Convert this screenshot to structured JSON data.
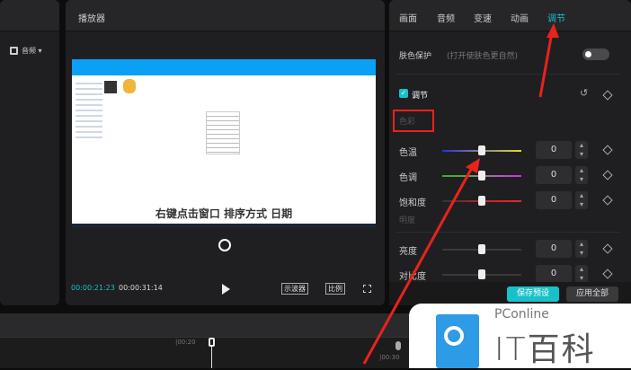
{
  "left_panel": {
    "dropdown_label": "音频"
  },
  "player": {
    "title": "播放器",
    "subtitle": "右键点击窗口 排序方式 日期",
    "current_time": "00:00:21:23",
    "total_time": "00:00:31:14",
    "scope_label": "示波器",
    "ratio_label": "比例"
  },
  "tabs": [
    {
      "label": "画面"
    },
    {
      "label": "音频"
    },
    {
      "label": "变速"
    },
    {
      "label": "动画"
    },
    {
      "label": "调节"
    }
  ],
  "skin": {
    "label": "肤色保护",
    "hint": "(打开使肤色更自然)",
    "enabled": false
  },
  "adjust": {
    "label": "调节",
    "checked": true,
    "section": "色彩",
    "section2": "明度"
  },
  "sliders": [
    {
      "label": "色温",
      "value": "0"
    },
    {
      "label": "色调",
      "value": "0"
    },
    {
      "label": "饱和度",
      "value": "0"
    },
    {
      "label": "亮度",
      "value": "0"
    },
    {
      "label": "对比度",
      "value": "0"
    }
  ],
  "buttons": {
    "save": "保存预设",
    "apply": "应用全部"
  },
  "timeline": {
    "tick1": "|00:20",
    "tick2": "|00:30"
  },
  "watermark": {
    "brand": "PConline",
    "name": "IT百科"
  },
  "colors": {
    "accent": "#18c1c9",
    "arrow": "#e8231c"
  }
}
